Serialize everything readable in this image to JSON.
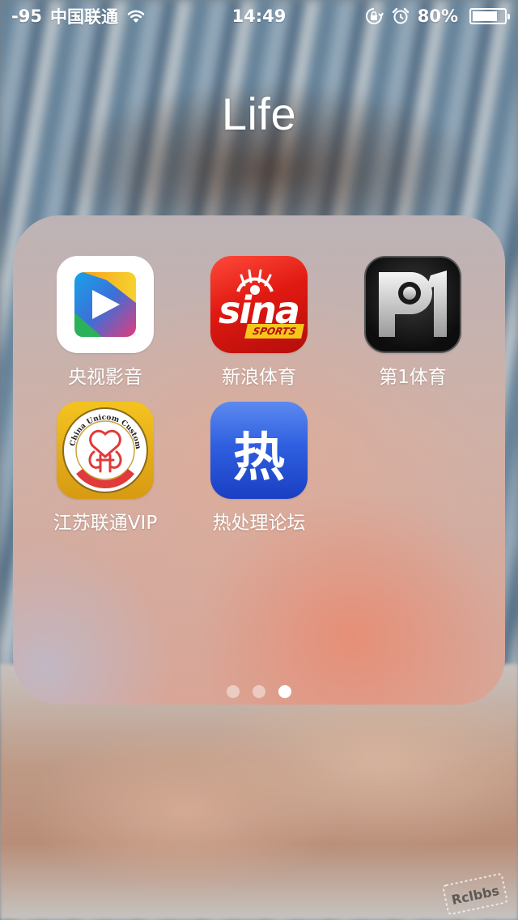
{
  "status_bar": {
    "signal": "-95",
    "carrier": "中国联通",
    "time": "14:49",
    "battery": "80%",
    "battery_level": 0.8
  },
  "folder": {
    "title": "Life",
    "apps": [
      {
        "label": "央视影音",
        "icon": "cctv-icon"
      },
      {
        "label": "新浪体育",
        "icon": "sina-sports-icon"
      },
      {
        "label": "第1体育",
        "icon": "di1-sports-icon"
      },
      {
        "label": "江苏联通VIP",
        "icon": "unicom-vip-icon"
      },
      {
        "label": "热处理论坛",
        "icon": "heat-treatment-forum-icon"
      }
    ],
    "page_count": 3,
    "active_page": 3
  },
  "icons": {
    "sina_word": "sina",
    "sports_badge": "SPORTS",
    "heat_char": "热",
    "unicom_seal_text": "China Unicom Customer Club"
  },
  "watermark": "Rclbbs"
}
